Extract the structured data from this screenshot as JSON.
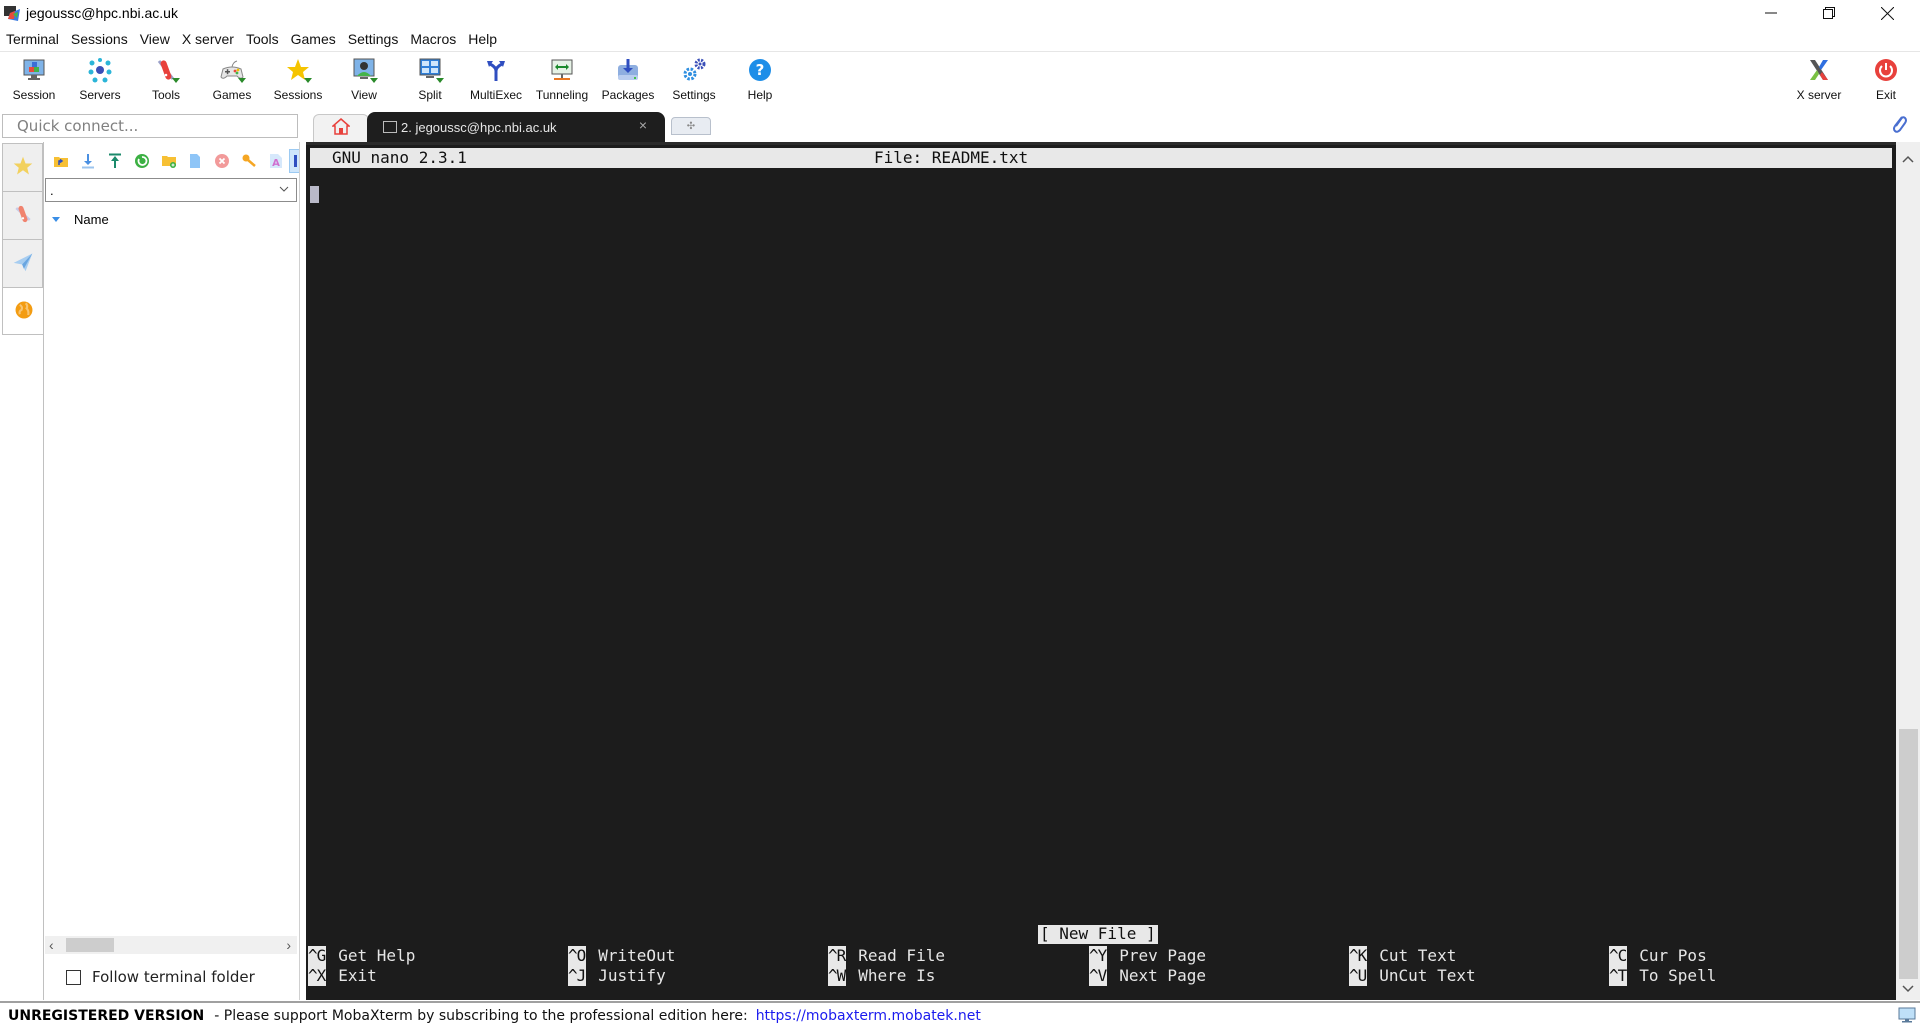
{
  "window": {
    "title": "jegoussc@hpc.nbi.ac.uk",
    "controls": {
      "minimize": "—",
      "maximize": "❐",
      "close": "✕"
    }
  },
  "menubar": {
    "items": [
      "Terminal",
      "Sessions",
      "View",
      "X server",
      "Tools",
      "Games",
      "Settings",
      "Macros",
      "Help"
    ]
  },
  "toolbar": {
    "buttons": [
      {
        "label": "Session",
        "icon": "session-icon"
      },
      {
        "label": "Servers",
        "icon": "servers-icon"
      },
      {
        "label": "Tools",
        "icon": "tools-icon"
      },
      {
        "label": "Games",
        "icon": "gamepad-icon"
      },
      {
        "label": "Sessions",
        "icon": "star-icon"
      },
      {
        "label": "View",
        "icon": "view-icon"
      },
      {
        "label": "Split",
        "icon": "split-icon"
      },
      {
        "label": "MultiExec",
        "icon": "multiexec-icon"
      },
      {
        "label": "Tunneling",
        "icon": "tunneling-icon"
      },
      {
        "label": "Packages",
        "icon": "packages-icon"
      },
      {
        "label": "Settings",
        "icon": "gears-icon"
      },
      {
        "label": "Help",
        "icon": "help-icon"
      }
    ],
    "right_buttons": [
      {
        "label": "X server",
        "icon": "xserver-icon"
      },
      {
        "label": "Exit",
        "icon": "power-icon"
      }
    ]
  },
  "quick_connect": {
    "placeholder": "Quick connect..."
  },
  "side_tabs": [
    {
      "name": "sessions",
      "icon": "star-icon",
      "active": false
    },
    {
      "name": "tools",
      "icon": "tools-icon",
      "active": false
    },
    {
      "name": "macros",
      "icon": "paper-plane-icon",
      "active": false
    },
    {
      "name": "sftp",
      "icon": "globe-icon",
      "active": true
    }
  ],
  "sftp": {
    "toolbar_icons": [
      "parent-folder-icon",
      "download-icon",
      "upload-icon",
      "refresh-icon",
      "new-folder-icon",
      "new-file-icon",
      "delete-icon",
      "permissions-key-icon",
      "text-file-icon",
      "more-icon"
    ],
    "path_value": ".",
    "column_header": "Name",
    "follow_terminal_folder": {
      "label": "Follow terminal folder",
      "checked": false
    }
  },
  "tabs": {
    "home_icon": "home-icon",
    "session_tab": {
      "label": "2. jegoussc@hpc.nbi.ac.uk",
      "close": "×"
    },
    "new_tab": "✣"
  },
  "terminal": {
    "header_left": "GNU nano 2.3.1",
    "header_center": "File: README.txt",
    "status_message": "[ New File ]",
    "shortcuts": [
      [
        {
          "key": "^G",
          "label": "Get Help"
        },
        {
          "key": "^X",
          "label": "Exit"
        }
      ],
      [
        {
          "key": "^O",
          "label": "WriteOut"
        },
        {
          "key": "^J",
          "label": "Justify"
        }
      ],
      [
        {
          "key": "^R",
          "label": "Read File"
        },
        {
          "key": "^W",
          "label": "Where Is"
        }
      ],
      [
        {
          "key": "^Y",
          "label": "Prev Page"
        },
        {
          "key": "^V",
          "label": "Next Page"
        }
      ],
      [
        {
          "key": "^K",
          "label": "Cut Text"
        },
        {
          "key": "^U",
          "label": "UnCut Text"
        }
      ],
      [
        {
          "key": "^C",
          "label": "Cur Pos"
        },
        {
          "key": "^T",
          "label": "To Spell"
        }
      ]
    ]
  },
  "statusbar": {
    "unregistered": "UNREGISTERED VERSION",
    "support": "-  Please support MobaXterm by subscribing to the professional edition here:",
    "link": "https://mobaxterm.mobatek.net"
  },
  "colors": {
    "terminal_bg": "#1c1c1c",
    "terminal_fg": "#e6e6e6",
    "nano_bar_bg": "#e8e8e8",
    "link": "#1a1aee",
    "exit_red": "#e8413c"
  }
}
